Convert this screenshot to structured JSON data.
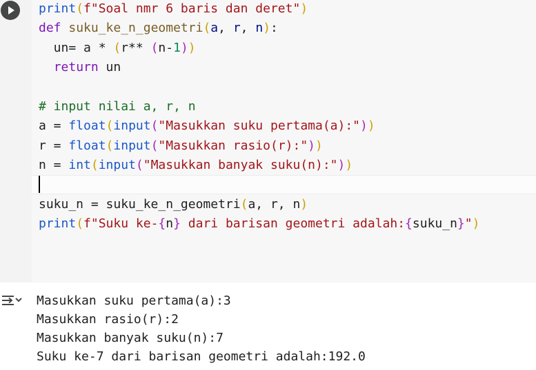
{
  "cell": {
    "run_button_icon": "play-icon",
    "output_toggle_icon": "output-collapse-icon",
    "lines": [
      {
        "tokens": [
          {
            "t": "print",
            "c": "bi"
          },
          {
            "t": "(",
            "c": "br1"
          },
          {
            "t": "f\"Soal nmr 6 baris dan deret\"",
            "c": "st"
          },
          {
            "t": ")",
            "c": "br1"
          }
        ]
      },
      {
        "tokens": [
          {
            "t": "def ",
            "c": "kw"
          },
          {
            "t": "suku_ke_n_geometri",
            "c": "fn"
          },
          {
            "t": "(",
            "c": "br1"
          },
          {
            "t": "a",
            "c": "prm"
          },
          {
            "t": ", ",
            "c": "pn"
          },
          {
            "t": "r",
            "c": "prm"
          },
          {
            "t": ", ",
            "c": "pn"
          },
          {
            "t": "n",
            "c": "prm"
          },
          {
            "t": ")",
            "c": "br1"
          },
          {
            "t": ":",
            "c": "pn"
          }
        ]
      },
      {
        "tokens": [
          {
            "t": "  un= a * ",
            "c": "pn"
          },
          {
            "t": "(",
            "c": "br1"
          },
          {
            "t": "r** ",
            "c": "pn"
          },
          {
            "t": "(",
            "c": "br2"
          },
          {
            "t": "n-",
            "c": "pn"
          },
          {
            "t": "1",
            "c": "nm"
          },
          {
            "t": ")",
            "c": "br2"
          },
          {
            "t": ")",
            "c": "br1"
          }
        ]
      },
      {
        "tokens": [
          {
            "t": "  ",
            "c": "pn"
          },
          {
            "t": "return",
            "c": "kw"
          },
          {
            "t": " un",
            "c": "pn"
          }
        ]
      },
      {
        "tokens": []
      },
      {
        "tokens": [
          {
            "t": "# input nilai a, r, n",
            "c": "cm"
          }
        ]
      },
      {
        "tokens": [
          {
            "t": "a = ",
            "c": "pn"
          },
          {
            "t": "float",
            "c": "bi"
          },
          {
            "t": "(",
            "c": "br1"
          },
          {
            "t": "input",
            "c": "bi"
          },
          {
            "t": "(",
            "c": "br2"
          },
          {
            "t": "\"Masukkan suku pertama(a):\"",
            "c": "st"
          },
          {
            "t": ")",
            "c": "br2"
          },
          {
            "t": ")",
            "c": "br1"
          }
        ]
      },
      {
        "tokens": [
          {
            "t": "r = ",
            "c": "pn"
          },
          {
            "t": "float",
            "c": "bi"
          },
          {
            "t": "(",
            "c": "br1"
          },
          {
            "t": "input",
            "c": "bi"
          },
          {
            "t": "(",
            "c": "br2"
          },
          {
            "t": "\"Masukkan rasio(r):\"",
            "c": "st"
          },
          {
            "t": ")",
            "c": "br2"
          },
          {
            "t": ")",
            "c": "br1"
          }
        ]
      },
      {
        "tokens": [
          {
            "t": "n = ",
            "c": "pn"
          },
          {
            "t": "int",
            "c": "bi"
          },
          {
            "t": "(",
            "c": "br1"
          },
          {
            "t": "input",
            "c": "bi"
          },
          {
            "t": "(",
            "c": "br2"
          },
          {
            "t": "\"Masukkan banyak suku(n):\"",
            "c": "st"
          },
          {
            "t": ")",
            "c": "br2"
          },
          {
            "t": ")",
            "c": "br1"
          }
        ]
      },
      {
        "tokens": []
      },
      {
        "tokens": [
          {
            "t": "suku_n = suku_ke_n_geometri",
            "c": "pn"
          },
          {
            "t": "(",
            "c": "br1"
          },
          {
            "t": "a, r, n",
            "c": "pn"
          },
          {
            "t": ")",
            "c": "br1"
          }
        ]
      },
      {
        "tokens": [
          {
            "t": "print",
            "c": "bi"
          },
          {
            "t": "(",
            "c": "br1"
          },
          {
            "t": "f\"Suku ke-",
            "c": "st"
          },
          {
            "t": "{",
            "c": "br2"
          },
          {
            "t": "n",
            "c": "pn"
          },
          {
            "t": "}",
            "c": "br2"
          },
          {
            "t": " dari barisan geometri adalah:",
            "c": "st"
          },
          {
            "t": "{",
            "c": "br2"
          },
          {
            "t": "suku_n",
            "c": "pn"
          },
          {
            "t": "}",
            "c": "br2"
          },
          {
            "t": "\"",
            "c": "st"
          },
          {
            "t": ")",
            "c": "br1"
          }
        ]
      }
    ]
  },
  "output": {
    "lines": [
      "Masukkan suku pertama(a):3",
      "Masukkan rasio(r):2",
      "Masukkan banyak suku(n):7",
      "Suku ke-7 dari barisan geometri adalah:192.0"
    ]
  }
}
